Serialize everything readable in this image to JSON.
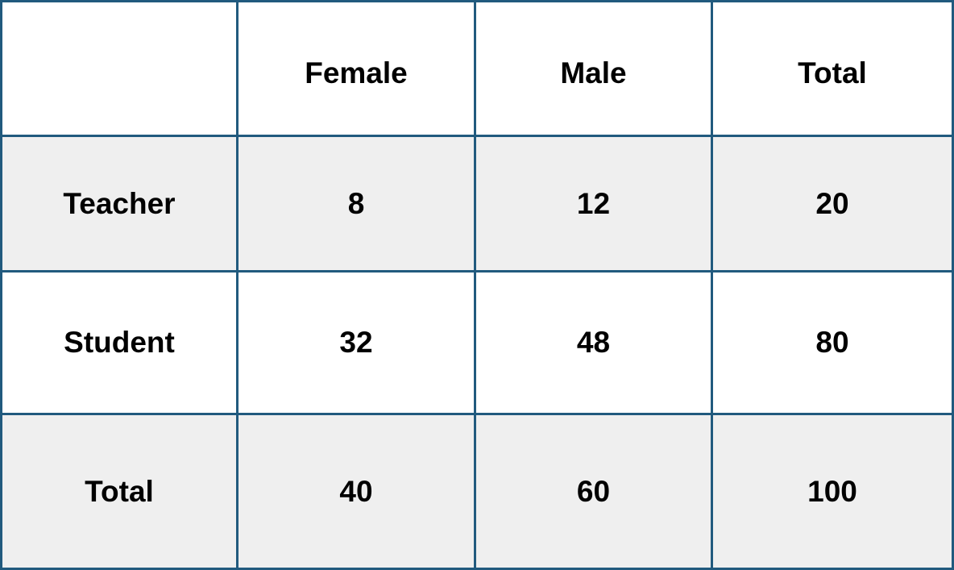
{
  "table": {
    "header": [
      "",
      "Female",
      "Male",
      "Total"
    ],
    "rows": [
      {
        "label": "Teacher",
        "values": [
          "8",
          "12",
          "20"
        ]
      },
      {
        "label": "Student",
        "values": [
          "32",
          "48",
          "80"
        ]
      },
      {
        "label": "Total",
        "values": [
          "40",
          "60",
          "100"
        ]
      }
    ]
  },
  "colors": {
    "border": "#215a7e",
    "shaded_row": "#efefef",
    "plain_row": "#ffffff",
    "text": "#000000"
  }
}
